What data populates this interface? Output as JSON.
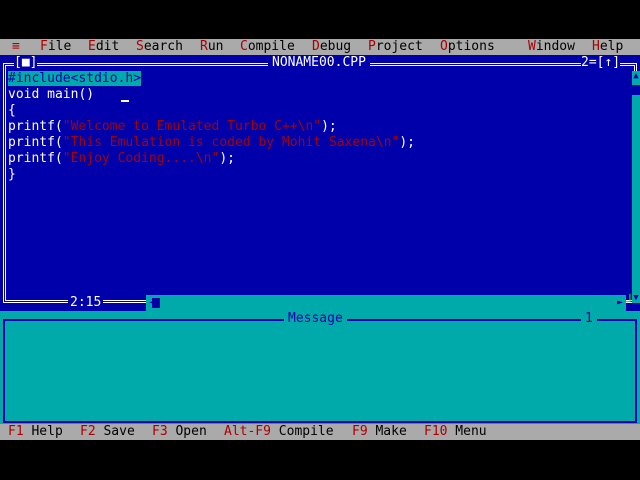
{
  "menu": {
    "system_symbol": "≡",
    "items": [
      {
        "hot": "F",
        "rest": "ile"
      },
      {
        "hot": "E",
        "rest": "dit"
      },
      {
        "hot": "S",
        "rest": "earch"
      },
      {
        "hot": "R",
        "rest": "un"
      },
      {
        "hot": "C",
        "rest": "ompile"
      },
      {
        "hot": "D",
        "rest": "ebug"
      },
      {
        "hot": "P",
        "rest": "roject"
      },
      {
        "hot": "O",
        "rest": "ptions"
      },
      {
        "hot": "W",
        "rest": "indow"
      },
      {
        "hot": "H",
        "rest": "elp"
      }
    ]
  },
  "editor": {
    "close_box": "[■]",
    "title": "NONAME00.CPP",
    "window_number": "2=[↑]",
    "cursor_position": "2:15",
    "code": [
      {
        "parts": [
          {
            "t": "#include<stdio.h>",
            "c": "hl"
          }
        ]
      },
      {
        "parts": [
          {
            "t": "void main()",
            "c": ""
          }
        ]
      },
      {
        "parts": [
          {
            "t": "{",
            "c": ""
          }
        ]
      },
      {
        "parts": [
          {
            "t": "printf(",
            "c": ""
          },
          {
            "t": "\"Welcome to Emulated Turbo C++\\n\"",
            "c": "str"
          },
          {
            "t": ");",
            "c": ""
          }
        ]
      },
      {
        "parts": [
          {
            "t": "printf(",
            "c": ""
          },
          {
            "t": "\"This Emulation is coded by Mohit Saxena\\n\"",
            "c": "str"
          },
          {
            "t": ");",
            "c": ""
          }
        ]
      },
      {
        "parts": [
          {
            "t": "printf(",
            "c": ""
          },
          {
            "t": "\"Enjoy Coding....\\n\"",
            "c": "str"
          },
          {
            "t": ");",
            "c": ""
          }
        ]
      },
      {
        "parts": [
          {
            "t": "}",
            "c": ""
          }
        ]
      }
    ]
  },
  "message_window": {
    "title": "Message",
    "number": "1"
  },
  "statusbar": {
    "items": [
      {
        "key": "F1",
        "label": " Help"
      },
      {
        "key": "F2",
        "label": " Save"
      },
      {
        "key": "F3",
        "label": " Open"
      },
      {
        "key": "Alt-F9",
        "label": " Compile"
      },
      {
        "key": "F9",
        "label": " Make"
      },
      {
        "key": "F10",
        "label": " Menu"
      }
    ]
  },
  "colors": {
    "editor_bg": "#0000AA",
    "menu_bg": "#AAAAAA",
    "hotkey": "#AA0000",
    "message_bg": "#00AAAA"
  }
}
